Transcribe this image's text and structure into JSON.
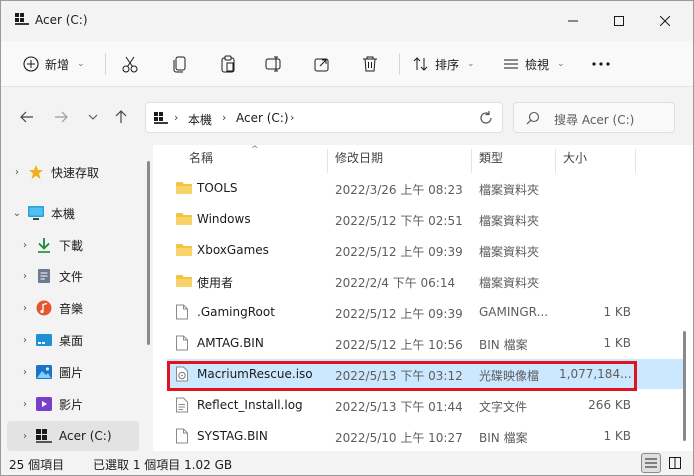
{
  "window": {
    "title": "Acer (C:)"
  },
  "toolbar": {
    "new_label": "新增",
    "sort_label": "排序",
    "view_label": "檢視"
  },
  "address": {
    "crumbs": [
      "本機",
      "Acer (C:)"
    ]
  },
  "search": {
    "placeholder": "搜尋 Acer (C:)"
  },
  "sidebar": {
    "items": [
      {
        "label": "快速存取",
        "icon": "star-icon"
      },
      {
        "label": "本機",
        "icon": "computer-icon"
      },
      {
        "label": "下載",
        "icon": "download-icon"
      },
      {
        "label": "文件",
        "icon": "document-icon"
      },
      {
        "label": "音樂",
        "icon": "music-icon"
      },
      {
        "label": "桌面",
        "icon": "desktop-icon"
      },
      {
        "label": "圖片",
        "icon": "picture-icon"
      },
      {
        "label": "影片",
        "icon": "video-icon"
      },
      {
        "label": "Acer (C:)",
        "icon": "drive-icon"
      }
    ]
  },
  "columns": {
    "name": "名稱",
    "date": "修改日期",
    "type": "類型",
    "size": "大小"
  },
  "files": [
    {
      "name": "TOOLS",
      "date": "2022/3/26 上午 08:23",
      "type": "檔案資料夾",
      "size": "",
      "kind": "folder"
    },
    {
      "name": "Windows",
      "date": "2022/5/12 下午 02:51",
      "type": "檔案資料夾",
      "size": "",
      "kind": "folder"
    },
    {
      "name": "XboxGames",
      "date": "2022/5/12 上午 09:39",
      "type": "檔案資料夾",
      "size": "",
      "kind": "folder"
    },
    {
      "name": "使用者",
      "date": "2022/2/4 下午 06:14",
      "type": "檔案資料夾",
      "size": "",
      "kind": "folder"
    },
    {
      "name": ".GamingRoot",
      "date": "2022/5/12 上午 09:39",
      "type": "GAMINGR...",
      "size": "1 KB",
      "kind": "file"
    },
    {
      "name": "AMTAG.BIN",
      "date": "2022/5/12 上午 10:56",
      "type": "BIN 檔案",
      "size": "1 KB",
      "kind": "file"
    },
    {
      "name": "MacriumRescue.iso",
      "date": "2022/5/13 下午 03:12",
      "type": "光碟映像檔",
      "size": "1,077,184...",
      "kind": "iso"
    },
    {
      "name": "Reflect_Install.log",
      "date": "2022/5/13 下午 01:44",
      "type": "文字文件",
      "size": "266 KB",
      "kind": "text"
    },
    {
      "name": "SYSTAG.BIN",
      "date": "2022/5/10 上午 10:27",
      "type": "BIN 檔案",
      "size": "1 KB",
      "kind": "file"
    }
  ],
  "status": {
    "count": "25 個項目",
    "selected": "已選取 1 個項目  1.02 GB"
  },
  "colors": {
    "accent": "#0067c0",
    "selection": "#cce8ff",
    "highlight_box": "#e0141e",
    "folder": "#f3c443"
  }
}
